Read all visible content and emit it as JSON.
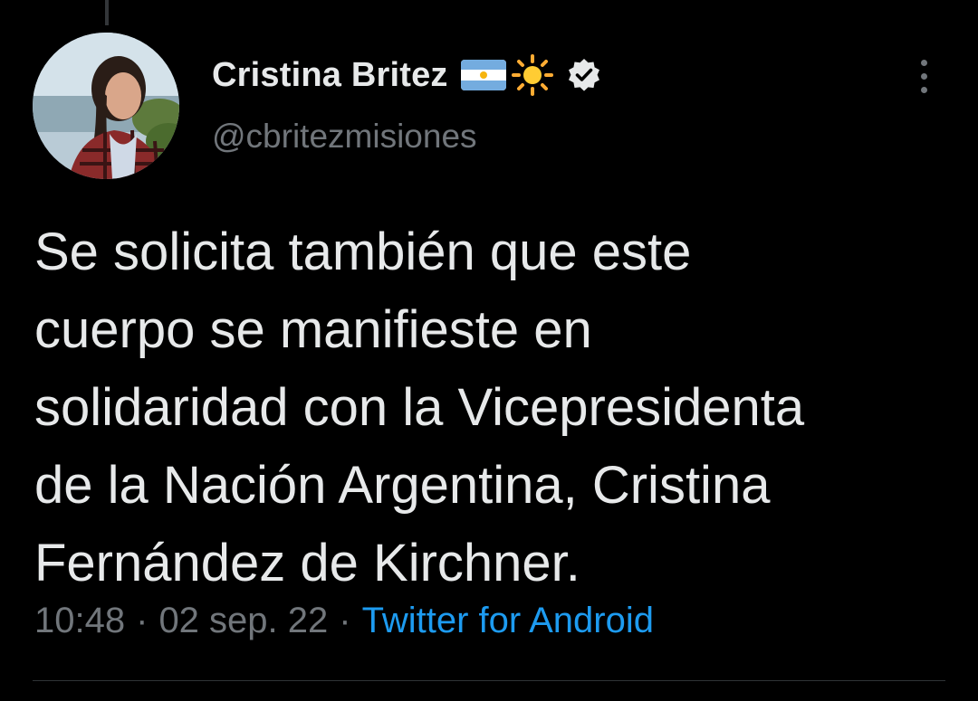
{
  "tweet": {
    "author": {
      "display_name": "Cristina Britez",
      "handle": "@cbritezmisiones",
      "avatar_icon": "profile-photo",
      "name_emojis": [
        "argentina-flag-icon",
        "sun-icon"
      ],
      "verified": true
    },
    "text_lines": [
      "Se solicita también que este",
      "cuerpo se manifieste en",
      "solidaridad con la Vicepresidenta",
      "de la Nación Argentina, Cristina",
      "Fernández de Kirchner."
    ],
    "meta": {
      "time": "10:48",
      "separator": "·",
      "date": "02 sep. 22",
      "source": "Twitter for Android"
    }
  },
  "colors": {
    "background": "#000000",
    "primary_text": "#e7e9ea",
    "secondary_text": "#71767b",
    "link": "#1d9bf0",
    "divider": "#2f3336"
  }
}
